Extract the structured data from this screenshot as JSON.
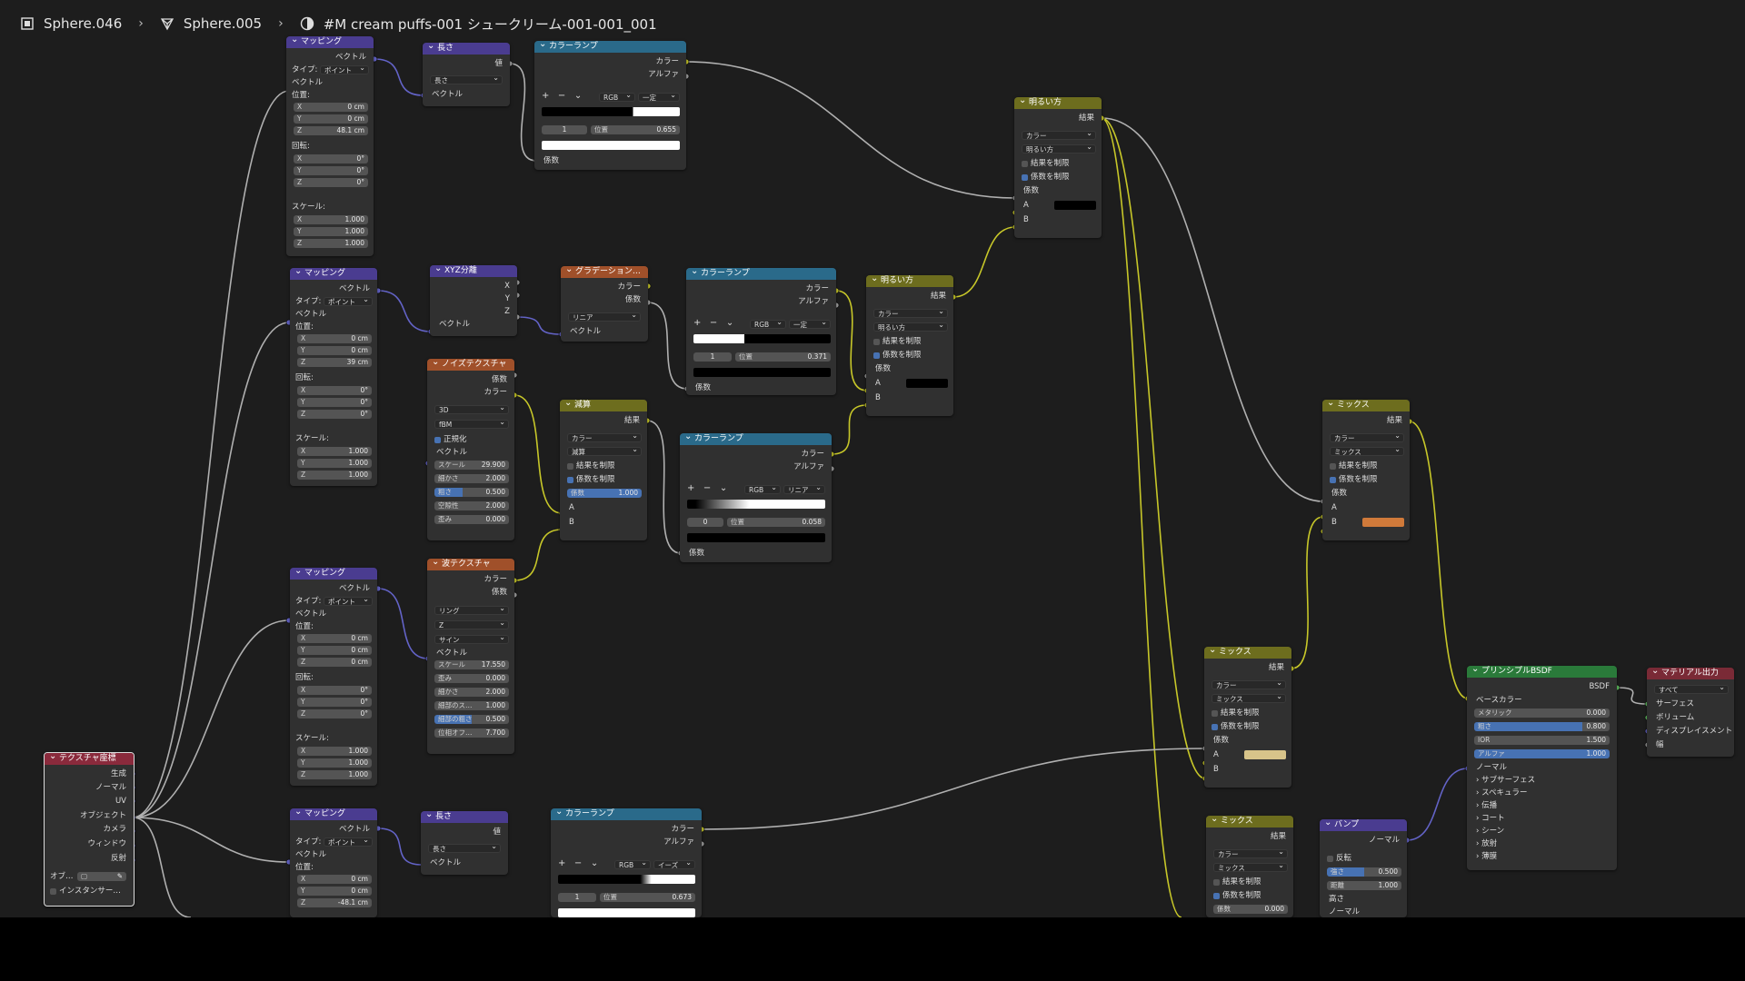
{
  "breadcrumb": {
    "object": "Sphere.046",
    "mesh": "Sphere.005",
    "material": "#M cream puffs-001 シュークリーム-001-001_001"
  },
  "labels": {
    "mapping": "マッピング",
    "vector": "ベクトル",
    "type": "タイプ:",
    "point": "ポイント",
    "location": "位置:",
    "rotation": "回転:",
    "scale": "スケール:",
    "x": "X",
    "y": "Y",
    "z": "Z",
    "length_node": "長さ",
    "value": "値",
    "length": "長さ",
    "colorramp": "カラーランプ",
    "color": "カラー",
    "alpha": "アルファ",
    "fac": "係数",
    "rgb": "RGB",
    "constant": "一定",
    "linear": "リニア",
    "ease": "イーズ",
    "pos": "位置",
    "lighten": "明るい方",
    "result": "結果",
    "clamp_result": "結果を制限",
    "clamp_fac": "係数を制限",
    "a": "A",
    "b": "B",
    "separate_xyz": "XYZ分離",
    "gradient": "グラデーションテ…",
    "noise": "ノイズテクスチャ",
    "wave": "波テクスチャ",
    "subtract": "減算",
    "mix": "ミックス",
    "principled": "プリンシプルBSDF",
    "output": "マテリアル出力",
    "bump": "バンプ",
    "texcoord": "テクスチャ座標",
    "dim3d": "3D",
    "fbm": "fBM",
    "normalize": "正規化",
    "ring": "リング",
    "sine": "サイン",
    "all": "すべて",
    "mixmode": "ミックス"
  },
  "mapping1": {
    "loc": [
      "0 cm",
      "0 cm",
      "48.1 cm"
    ],
    "rot": [
      "0°",
      "0°",
      "0°"
    ],
    "scale": [
      "1.000",
      "1.000",
      "1.000"
    ]
  },
  "mapping2": {
    "loc": [
      "0 cm",
      "0 cm",
      "39 cm"
    ],
    "rot": [
      "0°",
      "0°",
      "0°"
    ],
    "scale": [
      "1.000",
      "1.000",
      "1.000"
    ]
  },
  "mapping3": {
    "loc": [
      "0 cm",
      "0 cm",
      "0 cm"
    ],
    "rot": [
      "0°",
      "0°",
      "0°"
    ],
    "scale": [
      "1.000",
      "1.000",
      "1.000"
    ]
  },
  "mapping4": {
    "loc": [
      "0 cm",
      "0 cm",
      "-48.1 cm"
    ]
  },
  "ramp1": {
    "idx": "1",
    "pos": "0.655"
  },
  "ramp2": {
    "idx": "1",
    "pos": "0.371"
  },
  "ramp3": {
    "idx": "0",
    "pos": "0.058"
  },
  "ramp4": {
    "idx": "1",
    "pos": "0.673"
  },
  "noise": {
    "scale": "29.900",
    "detail": "2.000",
    "roughness": "0.500",
    "lacunarity": "2.000",
    "distortion": "0.000",
    "l_scale": "スケール",
    "l_detail": "細かさ",
    "l_rough": "粗さ",
    "l_lac": "空隙性",
    "l_dist": "歪み"
  },
  "wave": {
    "axis": "Z",
    "scale": "17.550",
    "distortion": "0.000",
    "detail": "2.000",
    "detail_scale": "1.000",
    "detail_rough": "0.500",
    "phase": "7.700",
    "l_scale": "スケール",
    "l_dist": "歪み",
    "l_detail": "細かさ",
    "l_dscale": "細部のス…",
    "l_drough": "細部の粗さ",
    "l_phase": "位相オフ…"
  },
  "subtract_fac": "1.000",
  "principled": {
    "base_color": "ベースカラー",
    "metallic": "メタリック",
    "metallic_v": "0.000",
    "roughness": "粗さ",
    "roughness_v": "0.800",
    "ior": "IOR",
    "ior_v": "1.500",
    "alpha": "アルファ",
    "alpha_v": "1.000",
    "normal": "ノーマル",
    "sections": [
      "サブサーフェス",
      "スペキュラー",
      "伝播",
      "コート",
      "シーン",
      "放射",
      "薄膜"
    ],
    "bsdf": "BSDF"
  },
  "output": {
    "surface": "サーフェス",
    "volume": "ボリューム",
    "displacement": "ディスプレイスメント",
    "thickness": "幅"
  },
  "bump": {
    "invert": "反転",
    "strength": "強さ",
    "strength_v": "0.500",
    "distance": "距離",
    "distance_v": "1.000",
    "height": "高さ",
    "normal": "ノーマル"
  },
  "mix_bottom": {
    "fac_v": "0.000"
  },
  "texcoord": {
    "outs": [
      "生成",
      "ノーマル",
      "UV",
      "オブジェクト",
      "カメラ",
      "ウィンドウ",
      "反射"
    ],
    "object_field": "オブ…",
    "instancer": "インスタンサー…"
  },
  "colors": {
    "mix_b_orange": "#d07a3a",
    "mix_a_cream": "#d8c48a",
    "yellow_wire": "#c7c729",
    "purple_wire": "#6363c7",
    "gray_wire": "#b0b0b0"
  }
}
